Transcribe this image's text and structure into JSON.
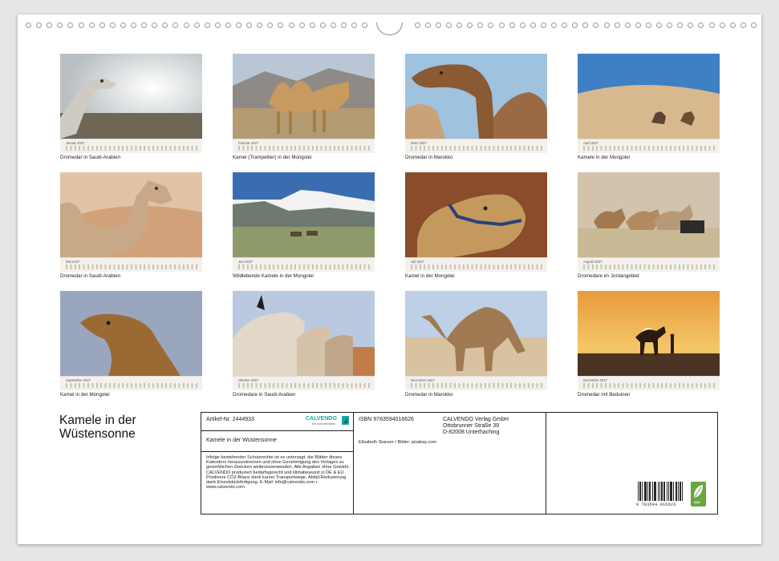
{
  "calendar": {
    "title": "Kamele in der Wüstensonne",
    "months": [
      {
        "label": "Januar",
        "caption": "Dromedar in Saudi-Arabien"
      },
      {
        "label": "Februar",
        "caption": "Kamel (Trampeltier) in der Mongolei"
      },
      {
        "label": "März",
        "caption": "Dromedar in Marokko"
      },
      {
        "label": "April",
        "caption": "Kamele in der Mongolei"
      },
      {
        "label": "Mai",
        "caption": "Dromedar in Saudi-Arabien"
      },
      {
        "label": "Juni",
        "caption": "Wildlebende Kamele in der Mongolei"
      },
      {
        "label": "Juli",
        "caption": "Kamel in der Mongolei"
      },
      {
        "label": "August",
        "caption": "Dromedare im Jordangebiet"
      },
      {
        "label": "September",
        "caption": "Kamel in der Mongolei"
      },
      {
        "label": "Oktober",
        "caption": "Dromedare in Saudi-Arabien"
      },
      {
        "label": "November",
        "caption": "Dromedar in Marokko"
      },
      {
        "label": "Dezember",
        "caption": "Dromedar mit Beduinen"
      }
    ],
    "month_year": "2027"
  },
  "info": {
    "article_label": "Artikel-Nr. 2444933",
    "brand_name": "CALVENDO",
    "brand_tagline": "Die Kalendermarke",
    "product_title": "Kamele in der Wüstensonne",
    "legal_text": "Infolge bestehender Schutzrechte ist es untersagt, die Blätter dieses Kalenders herauszutrennen und ohne Genehmigung des Verlages zu gewerblichen Zwecken weiterzuverwenden. Alle Angaben ohne Gewähr. CALVENDO produziert bedarfsgerecht und klimabewusst in DE & EU. Positivere CO2-Bilanz dank kurzer Transportwege. Abfall-Reduzierung dank Einzelstückfertigung. E-Mail: info@calvendo.com • www.calvendo.com",
    "isbn": "ISBN 9783594016626",
    "publisher_name": "CALVENDO Verlag GmbH",
    "publisher_street": "Ottobrunner Straße 39",
    "publisher_city": "D-82008 Unterhaching",
    "credits": "Elisabeth Stanzer / Bilder: pixabay.com",
    "barcode_number": "9 783594 016626",
    "eco_label": "eco"
  },
  "colors": {
    "sand": "#d9b98d",
    "sky": "#8fb4d8",
    "sunset": "#e9a24a",
    "eco_green": "#6aa63c",
    "calvendo_teal": "#1aa7a0"
  }
}
